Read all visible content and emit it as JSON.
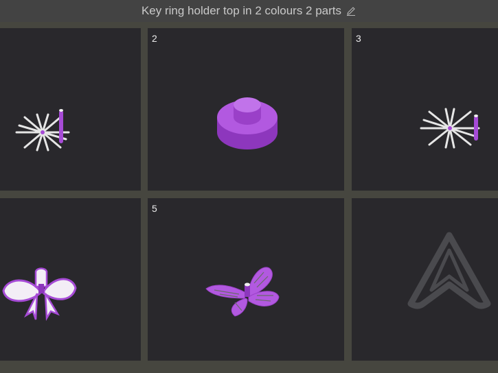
{
  "header": {
    "title": "Key ring holder top in 2 colours 2 parts",
    "edit_icon": "pencil-icon"
  },
  "plates": [
    {
      "number": "",
      "model": "spoke-wheel-with-pin"
    },
    {
      "number": "2",
      "model": "purple-disc-cap"
    },
    {
      "number": "3",
      "model": "spoke-wheel-with-pin"
    },
    {
      "number": "",
      "model": "purple-bow"
    },
    {
      "number": "5",
      "model": "purple-butterfly"
    },
    {
      "number": "",
      "model": "grey-arrow-logo"
    }
  ],
  "colors": {
    "filament_purple": "#a64bd6",
    "plate_bg": "#29282c",
    "frame": "#46463f",
    "ghost_grey": "#4a4a4e"
  }
}
